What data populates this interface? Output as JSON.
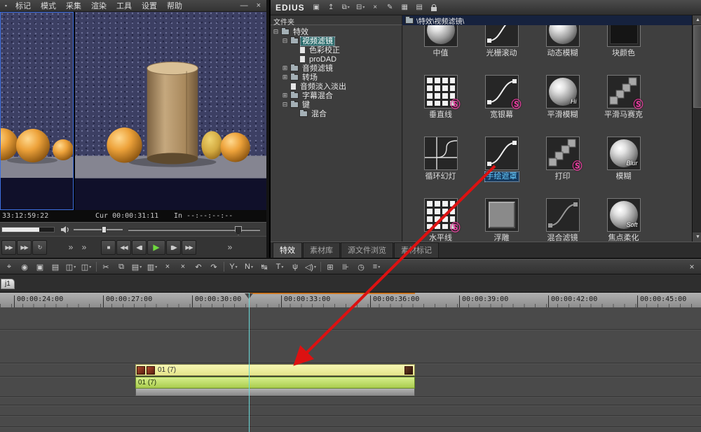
{
  "colors": {
    "selection_teal": "#2e6e6e",
    "effect_selected_blue": "#66ccff",
    "video_clip_yellow": "#eeee99",
    "audio_clip_green": "#b5d94f",
    "drag_arrow_red": "#dd1111",
    "preset_badge_pink": "#f43fa8",
    "play_button_green": "#6fd83e",
    "playhead_cyan": "#6adada",
    "path_bar_navy": "#16223e"
  },
  "preview_window": {
    "menu": [
      "标记",
      "模式",
      "采集",
      "渲染",
      "工具",
      "设置",
      "帮助"
    ],
    "window_controls": {
      "minimize": "—",
      "close": "×"
    },
    "timecodes": {
      "left": "33:12:59:22",
      "current": "Cur 00:00:31:11",
      "in": "In --:--:--:--"
    },
    "transport": [
      {
        "name": "play-around",
        "glyph": "▶▶"
      },
      {
        "name": "shuttle-play",
        "glyph": "▶▶"
      },
      {
        "name": "loop-play",
        "glyph": "↻"
      },
      {
        "name": "more-controls-left",
        "glyph": "»",
        "flat": true,
        "gap": 26
      },
      {
        "name": "more-controls-mid",
        "glyph": "»",
        "flat": true,
        "gap": 4
      },
      {
        "name": "stop",
        "glyph": "■",
        "gap": 16
      },
      {
        "name": "rewind",
        "glyph": "◀◀"
      },
      {
        "name": "previous-frame",
        "glyph": "◀▮"
      },
      {
        "name": "play",
        "glyph": "▶",
        "green": true
      },
      {
        "name": "next-frame",
        "glyph": "▮▶"
      },
      {
        "name": "fast-forward",
        "glyph": "▶▶"
      },
      {
        "name": "more-controls-right",
        "glyph": "»",
        "flat": true,
        "gap": 40
      }
    ]
  },
  "effects_window": {
    "title": "EDIUS",
    "toolbar": [
      {
        "name": "bin-window",
        "glyph": "▣"
      },
      {
        "name": "up-folder",
        "glyph": "↥"
      },
      {
        "name": "duplicate",
        "glyph": "⧉",
        "dd": true
      },
      {
        "name": "remove",
        "glyph": "⊟",
        "dd": true
      },
      {
        "name": "delete",
        "glyph": "×"
      },
      {
        "name": "properties",
        "glyph": "✎"
      },
      {
        "name": "view-thumbnail",
        "glyph": "▦"
      },
      {
        "name": "view-detail",
        "glyph": "▤"
      },
      {
        "name": "lock",
        "lock": true
      }
    ],
    "folder_header": "文件夹",
    "path": "\\特效\\视频滤镜\\",
    "tree": [
      {
        "label": "特效",
        "level": 0,
        "expander": "-",
        "icon": "folder"
      },
      {
        "label": "视频滤镜",
        "level": 1,
        "expander": "-",
        "icon": "folder",
        "selected": true
      },
      {
        "label": "色彩校正",
        "level": 2,
        "expander": "",
        "icon": "doc"
      },
      {
        "label": "proDAD",
        "level": 2,
        "expander": "",
        "icon": "doc"
      },
      {
        "label": "音频滤镜",
        "level": 1,
        "expander": "+",
        "icon": "folder"
      },
      {
        "label": "转场",
        "level": 1,
        "expander": "+",
        "icon": "folder"
      },
      {
        "label": "音频淡入淡出",
        "level": 1,
        "expander": "",
        "icon": "doc"
      },
      {
        "label": "字幕混合",
        "level": 1,
        "expander": "+",
        "icon": "folder"
      },
      {
        "label": "键",
        "level": 1,
        "expander": "-",
        "icon": "folder"
      },
      {
        "label": "混合",
        "level": 2,
        "expander": "",
        "icon": "folder"
      }
    ],
    "effects": [
      {
        "label": "中值",
        "icon": "sphere"
      },
      {
        "label": "光栅滚动",
        "icon": "curve"
      },
      {
        "label": "动态模糊",
        "icon": "sphere"
      },
      {
        "label": "块颜色",
        "icon": "dark"
      },
      {
        "label": "垂直线",
        "icon": "grid",
        "badge": "Ⓢ"
      },
      {
        "label": "宽银幕",
        "icon": "curve",
        "badge": "Ⓢ"
      },
      {
        "label": "平滑模糊",
        "icon": "sphere",
        "overlay": "Hi"
      },
      {
        "label": "平滑马赛克",
        "icon": "steps",
        "badge": "Ⓢ"
      },
      {
        "label": "循环幻灯",
        "icon": "quadrant"
      },
      {
        "label": "手绘遮罩",
        "icon": "curve",
        "selected": true
      },
      {
        "label": "打印",
        "icon": "steps",
        "badge": "Ⓢ"
      },
      {
        "label": "模糊",
        "icon": "sphere",
        "overlay": "Blur"
      },
      {
        "label": "水平线",
        "icon": "grid",
        "badge": "Ⓢ"
      },
      {
        "label": "浮雕",
        "icon": "emboss"
      },
      {
        "label": "混合滤镜",
        "icon": "curve-grey"
      },
      {
        "label": "焦点柔化",
        "icon": "sphere",
        "overlay": "Soft"
      }
    ],
    "scrollbar": {
      "up": "▲",
      "down": "▼"
    },
    "tabs": [
      {
        "label": "特效",
        "active": true
      },
      {
        "label": "素材库"
      },
      {
        "label": "源文件浏览"
      },
      {
        "label": "素材标记"
      }
    ]
  },
  "timeline_toolbar": {
    "close": "×",
    "icons": [
      {
        "name": "select",
        "glyph": "⌖"
      },
      {
        "name": "capture",
        "glyph": "◉"
      },
      {
        "name": "add-file",
        "glyph": "▣"
      },
      {
        "name": "open-bin",
        "glyph": "▤"
      },
      {
        "name": "save-project",
        "glyph": "◫",
        "dd": true
      },
      {
        "name": "export",
        "glyph": "◫",
        "dd": true
      },
      {
        "name": "cut",
        "glyph": "✂",
        "sep": true
      },
      {
        "name": "copy",
        "glyph": "⧉"
      },
      {
        "name": "paste",
        "glyph": "▤",
        "dd": true
      },
      {
        "name": "replace",
        "glyph": "▥",
        "dd": true
      },
      {
        "name": "delete",
        "glyph": "×"
      },
      {
        "name": "ripple-delete",
        "glyph": "×"
      },
      {
        "name": "undo",
        "glyph": "↶"
      },
      {
        "name": "redo",
        "glyph": "↷"
      },
      {
        "name": "patch-video",
        "glyph": "Y",
        "dd": true,
        "sep": true
      },
      {
        "name": "patch-audio",
        "glyph": "N",
        "dd": true
      },
      {
        "name": "sync-mode",
        "glyph": "↹"
      },
      {
        "name": "title",
        "glyph": "T",
        "dd": true
      },
      {
        "name": "voiceover-mic",
        "glyph": "ψ"
      },
      {
        "name": "audio-monitor",
        "glyph": "◁)",
        "dd": true
      },
      {
        "name": "mixer-grid",
        "glyph": "⊞",
        "sep": true
      },
      {
        "name": "audio-mixer",
        "glyph": "⊪"
      },
      {
        "name": "duration",
        "glyph": "◷"
      },
      {
        "name": "bin-list",
        "glyph": "≡",
        "dd": true
      }
    ]
  },
  "timeline": {
    "sequence_tab": "j1",
    "ruler_ticks": [
      "00:00:24:00",
      "00:00:27:00",
      "00:00:30:00",
      "00:00:33:00",
      "00:00:36:00",
      "00:00:39:00",
      "00:00:42:00",
      "00:00:45:00"
    ],
    "clips": {
      "video_label": "01 (7)",
      "audio_label": "01 (7)"
    }
  }
}
